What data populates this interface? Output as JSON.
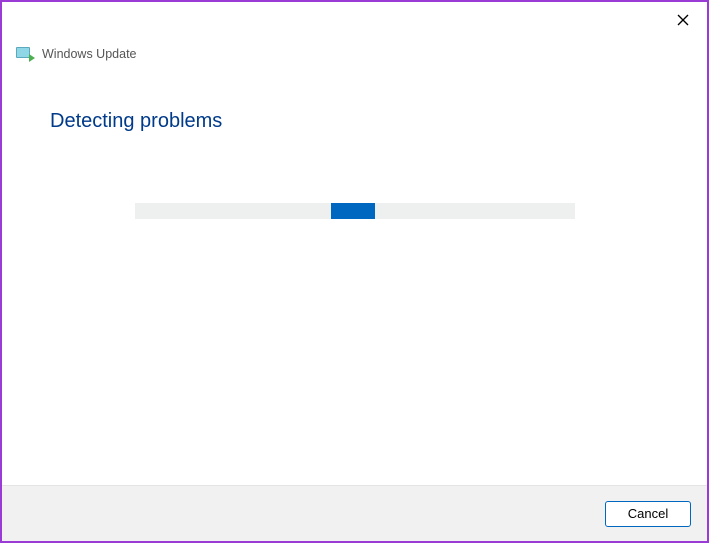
{
  "header": {
    "title": "Windows Update",
    "icon": "troubleshoot-icon"
  },
  "page": {
    "title": "Detecting problems"
  },
  "progress": {
    "indeterminate": true
  },
  "footer": {
    "cancel_label": "Cancel"
  }
}
